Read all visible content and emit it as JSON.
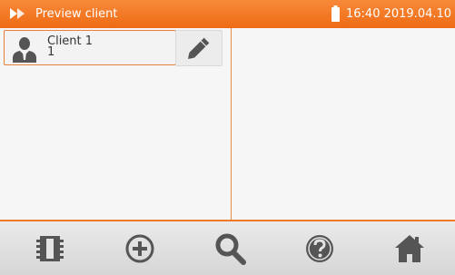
{
  "titlebar": {
    "title": "Preview client",
    "clock": "16:40 2019.04.10",
    "app_icon": "double-arrow-icon",
    "battery_icon": "battery-icon"
  },
  "clients": [
    {
      "name": "Client 1",
      "number": "1",
      "icon": "person-icon"
    }
  ],
  "toolbar": {
    "items": [
      {
        "icon": "memory-card-icon"
      },
      {
        "icon": "add-circle-icon"
      },
      {
        "icon": "search-icon"
      },
      {
        "icon": "help-icon"
      },
      {
        "icon": "home-icon"
      }
    ]
  },
  "colors": {
    "accent": "#ef6a14",
    "icon": "#555555"
  }
}
